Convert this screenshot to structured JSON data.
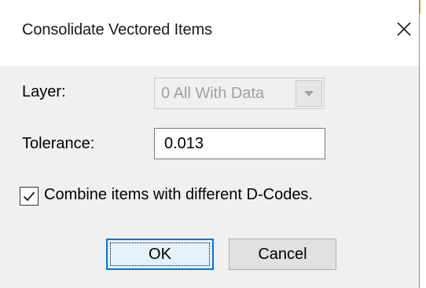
{
  "window": {
    "title": "Consolidate Vectored Items",
    "close_icon": "close-icon"
  },
  "layer": {
    "label": "Layer:",
    "selected": "0 All With Data",
    "enabled": false,
    "dropdown_icon": "chevron-down-icon"
  },
  "tolerance": {
    "label": "Tolerance:",
    "value": "0.013"
  },
  "combine": {
    "label": "Combine items with different D-Codes.",
    "checked": true,
    "check_icon": "checkmark-icon"
  },
  "buttons": {
    "ok_label": "OK",
    "cancel_label": "Cancel"
  },
  "colors": {
    "focus_accent": "#0078d7",
    "disabled_text": "#a0a0a0",
    "dialog_background": "#f0f0f0"
  }
}
